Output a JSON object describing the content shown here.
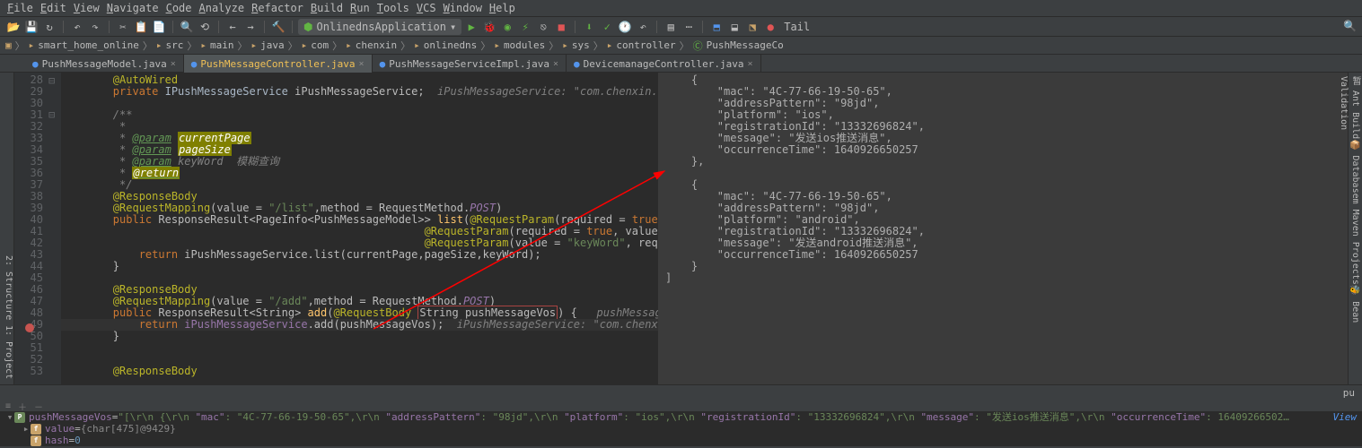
{
  "menu": [
    "File",
    "Edit",
    "View",
    "Navigate",
    "Code",
    "Analyze",
    "Refactor",
    "Build",
    "Run",
    "Tools",
    "VCS",
    "Window",
    "Help"
  ],
  "run_config_label": "OnlinednsApplication",
  "run_config_suffix": "▾",
  "extra_label": "Tail",
  "breadcrumbs": [
    "smart_home_online",
    "src",
    "main",
    "java",
    "com",
    "chenxin",
    "onlinedns",
    "modules",
    "sys",
    "controller",
    "PushMessageCo"
  ],
  "tabs": [
    {
      "label": "PushMessageModel.java",
      "icon": "●",
      "active": false
    },
    {
      "label": "PushMessageController.java",
      "icon": "●",
      "active": true
    },
    {
      "label": "PushMessageServiceImpl.java",
      "icon": "●",
      "active": false
    },
    {
      "label": "DevicemanageController.java",
      "icon": "●",
      "active": false
    }
  ],
  "left_tools": [
    "2: Structure",
    "1: Project"
  ],
  "right_tools": [
    "暂 Ant Build",
    "📦 Database",
    "m Maven Projects",
    "🐝 Bean Validation"
  ],
  "gutter_start": 28,
  "gutter_end": 53,
  "code_lines": [
    {
      "k": "ann",
      "t": "        @AutoWired"
    },
    {
      "raw": "        <span class='kw'>private</span> <span class='type'>IPushMessageService</span> iPushMessageService;  <span class='comment'>iPushMessageService: \"com.chenxin.onlinedns.modules.</span>"
    },
    {
      "raw": ""
    },
    {
      "raw": "        <span class='comment'>/**</span>"
    },
    {
      "raw": "        <span class='comment'> *</span>"
    },
    {
      "raw": "        <span class='comment'> * <span class='param'>@param</span> <span class='underline-y'>currentPage</span></span>"
    },
    {
      "raw": "        <span class='comment'> * <span class='param'>@param</span> <span class='underline-y'>pageSize</span></span>"
    },
    {
      "raw": "        <span class='comment'> * <span class='param'>@param</span> keyWord  模糊查询</span>"
    },
    {
      "raw": "        <span class='comment'> * <span class='param'><span class='underline-y'>@return</span></span></span>"
    },
    {
      "raw": "        <span class='comment'> */</span>"
    },
    {
      "raw": "        <span class='ann'>@ResponseBody</span>"
    },
    {
      "raw": "        <span class='ann'>@RequestMapping</span>(value = <span class='str'>\"/list\"</span>,method = RequestMethod.<span style='color:#9876aa;font-style:italic'>POST</span>)"
    },
    {
      "raw": "        <span class='kw'>public</span> ResponseResult&lt;PageInfo&lt;PushMessageModel&gt;&gt; <span class='method'>list</span>(<span class='ann'>@RequestParam</span>(required = <span class='kw'>true</span>, value = <span class='str'>\"current</span>"
    },
    {
      "raw": "                                                        <span class='ann'>@RequestParam</span>(required = <span class='kw'>true</span>, value = <span class='str'>\"pageSiz</span>"
    },
    {
      "raw": "                                                        <span class='ann'>@RequestParam</span>(value = <span class='str'>\"keyWord\"</span>, required = <span class='kw'>fal</span>"
    },
    {
      "raw": "            <span class='kw'>return</span> iPushMessageService.list(currentPage,pageSize,keyWord);"
    },
    {
      "raw": "        }"
    },
    {
      "raw": ""
    },
    {
      "raw": "        <span class='ann'>@ResponseBody</span>"
    },
    {
      "raw": "        <span class='ann'>@RequestMapping</span>(value = <span class='str'>\"/add\"</span>,method = RequestMethod.<span style='color:#9876aa;font-style:italic'>POST</span>)"
    },
    {
      "raw": "        <span class='kw'>public</span> ResponseResult&lt;String&gt; <span class='method'>add</span>(<span class='ann'>@RequestBody</span> <span class='boxed'>String pushMessageVos</span>) {   <span class='comment'>pushMessageVos: \"[\\r\\n    {\\r\\n</span>"
    },
    {
      "raw": "<span class='line-sel'>            <span class='return-stmt'>return</span> <span style='color:#9876aa'>iPushMessageService</span>.add(pushMessageVos);  <span class='comment'>iPushMessageService: \"com.chenxin.onlinedns.modul</span></span>"
    },
    {
      "raw": "        }"
    },
    {
      "raw": ""
    },
    {
      "raw": ""
    },
    {
      "raw": "        <span class='ann'>@ResponseBody</span>"
    }
  ],
  "status_right": "pu",
  "json_popup_lines": [
    "    {",
    "        \"mac\": \"4C-77-66-19-50-65\",",
    "        \"addressPattern\": \"98jd\",",
    "        \"platform\": \"ios\",",
    "        \"registrationId\": \"13332696824\",",
    "        \"message\": \"发送ios推送消息\",",
    "        \"occurrenceTime\": 1640926650257",
    "    },",
    "",
    "    {",
    "        \"mac\": \"4C-77-66-19-50-65\",",
    "        \"addressPattern\": \"98jd\",",
    "        \"platform\": \"android\",",
    "        \"registrationId\": \"13332696824\",",
    "        \"message\": \"发送android推送消息\",",
    "        \"occurrenceTime\": 1640926650257",
    "    }",
    "]"
  ],
  "debug": {
    "var_name": "pushMessageVos",
    "var_preview_parts": [
      {
        "val": "\"[\\r\\n    {\\r\\n        "
      },
      {
        "key": "\"mac\"",
        "val": ": \"4C-77-66-19-50-65\",\\r\\n        "
      },
      {
        "key": "\"addressPattern\"",
        "val": ": \"98jd\",\\r\\n        "
      },
      {
        "key": "\"platform\"",
        "val": ": \"ios\",\\r\\n        "
      },
      {
        "key": "\"registrationId\"",
        "val": ": \"13332696824\",\\r\\n        "
      },
      {
        "key": "\"message\"",
        "val": ": \"发送ios推送消息\",\\r\\n        "
      },
      {
        "key": "\"occurrenceTime\"",
        "val": ": 16409266502…"
      }
    ],
    "view_label": "View",
    "value_label": "value",
    "value_detail": "{char[475]@9429}",
    "hash_label": "hash",
    "hash_value": "0"
  }
}
